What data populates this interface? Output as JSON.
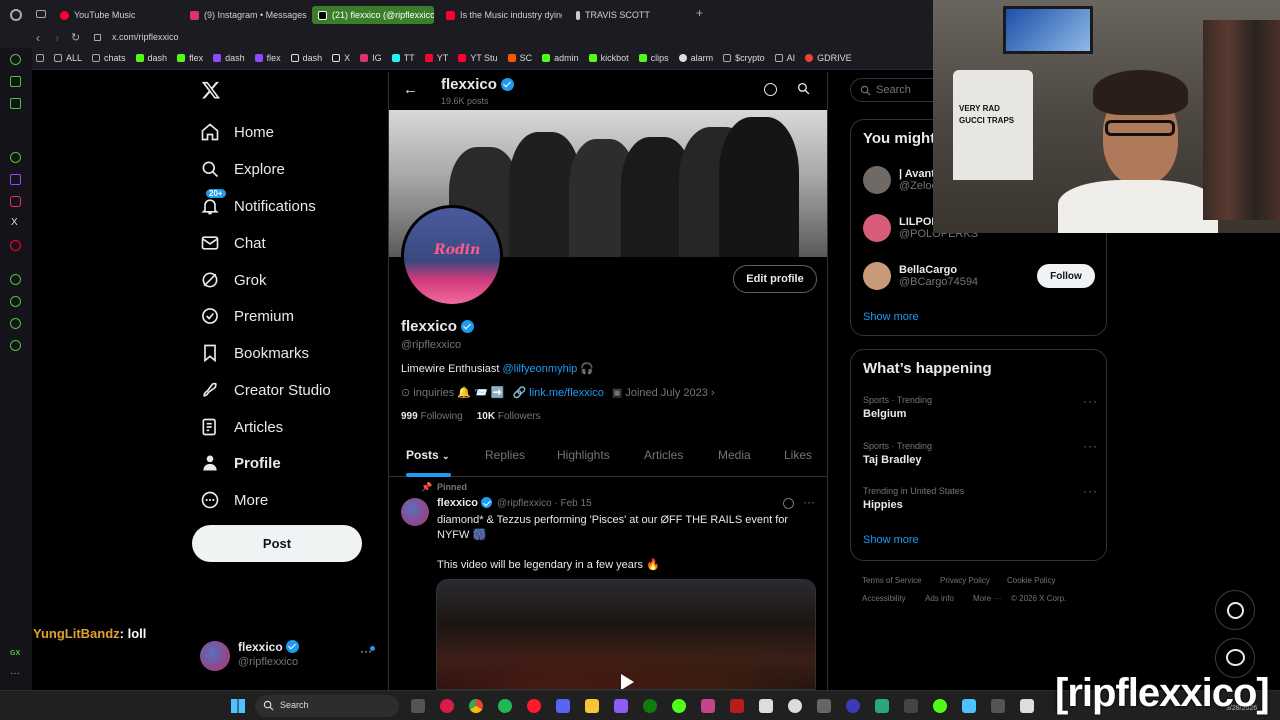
{
  "browser": {
    "tabs": [
      {
        "label": "YouTube Music",
        "color": "#ff0033",
        "active": false
      },
      {
        "label": "(9) Instagram • Messages",
        "color": "#e1306c",
        "active": false
      },
      {
        "label": "(21) flexxico (@ripflexxico",
        "color": "#ffffff",
        "active": true
      },
      {
        "label": "Is the Music industry dying",
        "color": "#ff0033",
        "active": false
      },
      {
        "label": "TRAVIS SCOTT",
        "color": "#cccccc",
        "active": false
      }
    ],
    "url": "x.com/ripflexxico",
    "bookmarks": [
      "ALL",
      "chats",
      "dash",
      "flex",
      "dash",
      "flex",
      "dash",
      "X",
      "IG",
      "TT",
      "YT",
      "YT Stu",
      "SC",
      "admin",
      "kickbot",
      "clips",
      "alarm",
      "$crypto",
      "AI",
      "GDRIVE"
    ]
  },
  "nav": {
    "logo": "X",
    "home": "Home",
    "explore": "Explore",
    "notifications": "Notifications",
    "notifications_badge": "20+",
    "chat": "Chat",
    "grok": "Grok",
    "premium": "Premium",
    "bookmarks": "Bookmarks",
    "creator_studio": "Creator Studio",
    "articles": "Articles",
    "profile": "Profile",
    "more": "More",
    "post": "Post"
  },
  "account": {
    "name": "flexxico",
    "handle": "@ripflexxico"
  },
  "chat_overlay": {
    "user": "YungLitBandz",
    "message": ": loll"
  },
  "profile": {
    "header_name": "flexxico",
    "post_count": "19.6K posts",
    "name": "flexxico",
    "handle": "@ripflexxico",
    "edit_button": "Edit profile",
    "bio_text": "Limewire Enthusiast ",
    "bio_link": "@lilfyeonmyhip",
    "bio_emoji": "🎧",
    "location": "inquiries 🔔 📨 ➡️",
    "website": "link.me/flexxico",
    "joined": "Joined July 2023",
    "following_count": "999",
    "following_label": "Following",
    "followers_count": "10K",
    "followers_label": "Followers",
    "avatar_text": "Rodin"
  },
  "profile_tabs": [
    "Posts",
    "Replies",
    "Highlights",
    "Articles",
    "Media",
    "Likes"
  ],
  "tweet": {
    "pinned_label": "Pinned",
    "name": "flexxico",
    "meta": "@ripflexxico · Feb 15",
    "text_line1": "diamond* & Tezzus performing 'Pisces' at our ØFF THE RAILS event for",
    "text_line2": "NYFW 🎆",
    "text_line3": "This video will be legendary in a few years 🔥"
  },
  "sidebar": {
    "search_placeholder": "Search",
    "who_to_follow_title": "You might",
    "suggestions": [
      {
        "name": "| Avant",
        "handle": "@Zeloc",
        "color": "#6f6a66"
      },
      {
        "name": "LILPOL",
        "handle": "@POLOPERKS",
        "color": "#d65c7a"
      },
      {
        "name": "BellaCargo",
        "handle": "@BCargo74594",
        "color": "#c89a7a"
      }
    ],
    "follow_label": "Follow",
    "show_more": "Show more",
    "happening_title": "What’s happening",
    "trends": [
      {
        "category": "Sports · Trending",
        "title": "Belgium"
      },
      {
        "category": "Sports · Trending",
        "title": "Taj Bradley"
      },
      {
        "category": "Trending in United States",
        "title": "Hippies"
      }
    ],
    "show_more_2": "Show more",
    "footer": [
      "Terms of Service",
      "Privacy Policy",
      "Cookie Policy",
      "Accessibility",
      "Ads info",
      "More ···",
      "© 2026 X Corp."
    ]
  },
  "stream": {
    "overlay_name": "[ripflexxico]",
    "shirt_text_1": "VERY RAD",
    "shirt_text_2": "GUCCI TRAPS"
  },
  "taskbar": {
    "search": "Search",
    "date": "3/28/2026"
  }
}
